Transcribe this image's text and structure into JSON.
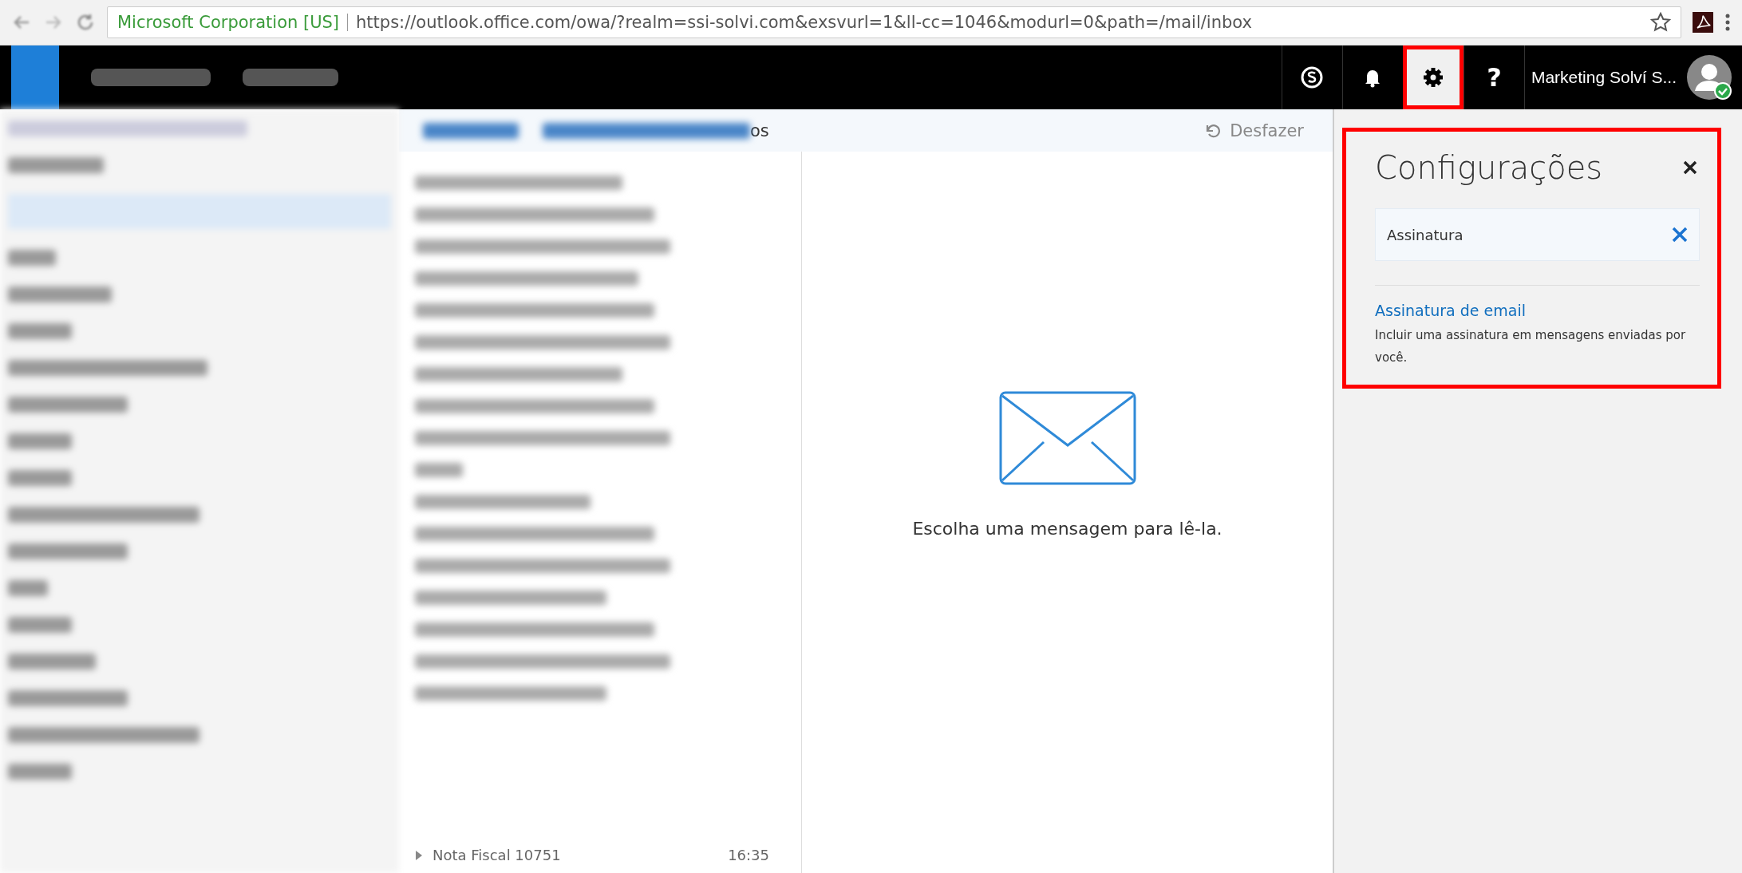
{
  "browser": {
    "identity": "Microsoft Corporation [US]",
    "url": "https://outlook.office.com/owa/?realm=ssi-solvi.com&exsvurl=1&ll-cc=1046&modurl=0&path=/mail/inbox"
  },
  "header": {
    "icons": [
      {
        "kind": "skype",
        "selected": false
      },
      {
        "kind": "bell",
        "selected": false
      },
      {
        "kind": "gear",
        "selected": true
      },
      {
        "kind": "help",
        "glyph": "?",
        "selected": false
      }
    ],
    "user_name": "Marketing Solví S..."
  },
  "toolbar": {
    "fragment": "os",
    "undo": "Desfazer"
  },
  "message_list": {
    "visible_row": {
      "subject": "Nota Fiscal 10751",
      "time": "16:35"
    }
  },
  "reading_pane": {
    "empty_message": "Escolha uma mensagem para lê-la."
  },
  "settings": {
    "title": "Configurações",
    "search": {
      "value": "Assinatura"
    },
    "results": [
      {
        "title": "Assinatura de email",
        "description": "Incluir uma assinatura em mensagens enviadas por você."
      }
    ]
  }
}
